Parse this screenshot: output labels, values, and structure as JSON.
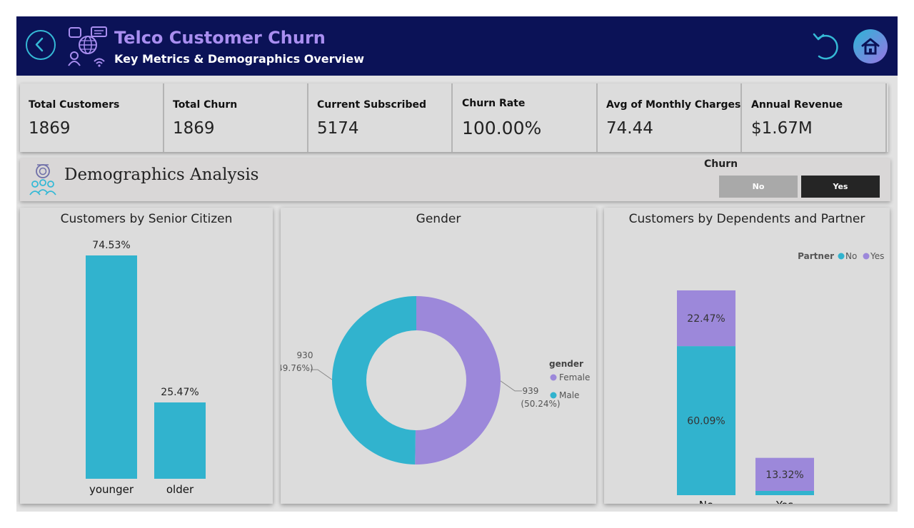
{
  "header": {
    "title": "Telco Customer Churn",
    "subtitle": "Key Metrics & Demographics Overview"
  },
  "kpis": [
    {
      "label": "Total Customers",
      "value": "1869"
    },
    {
      "label": "Total Churn",
      "value": "1869"
    },
    {
      "label": "Current Subscribed",
      "value": "5174"
    },
    {
      "label": "Churn Rate",
      "value": "100.00%"
    },
    {
      "label": "Avg of Monthly Charges",
      "value": "74.44"
    },
    {
      "label": "Annual Revenue",
      "value": "$1.67M"
    }
  ],
  "demographics": {
    "title": "Demographics Analysis",
    "slicer": {
      "title": "Churn",
      "options": [
        "No",
        "Yes"
      ],
      "selected": "Yes"
    }
  },
  "colors": {
    "teal": "#31b3ce",
    "purple": "#9c88da",
    "header": "#0b1257"
  },
  "chart_data": [
    {
      "type": "bar",
      "title": "Customers by Senior Citizen",
      "categories": [
        "younger",
        "older"
      ],
      "values": [
        74.53,
        25.47
      ],
      "labels": [
        "74.53%",
        "25.47%"
      ],
      "ylim": [
        0,
        74.53
      ],
      "grid": false,
      "color": "#31b3ce"
    },
    {
      "type": "pie",
      "title": "Gender",
      "legend_title": "gender",
      "legend_position": "right",
      "slices": [
        {
          "name": "Female",
          "value": 939,
          "percent": "(50.24%)",
          "color": "#9c88da"
        },
        {
          "name": "Male",
          "value": 930,
          "percent": "(49.76%)",
          "color": "#31b3ce"
        }
      ]
    },
    {
      "type": "bar",
      "stacked": true,
      "title": "Customers by Dependents and Partner",
      "legend_title": "Partner",
      "legend_position": "top-right",
      "categories": [
        "No",
        "Yes"
      ],
      "series": [
        {
          "name": "No",
          "values": [
            60.09,
            1.73
          ],
          "labels": [
            "60.09%",
            ""
          ],
          "color": "#31b3ce"
        },
        {
          "name": "Yes",
          "values": [
            22.47,
            13.32
          ],
          "labels": [
            "22.47%",
            "13.32%"
          ],
          "color": "#9c88da"
        }
      ],
      "ylim": [
        0,
        82.56
      ],
      "grid": false
    }
  ]
}
